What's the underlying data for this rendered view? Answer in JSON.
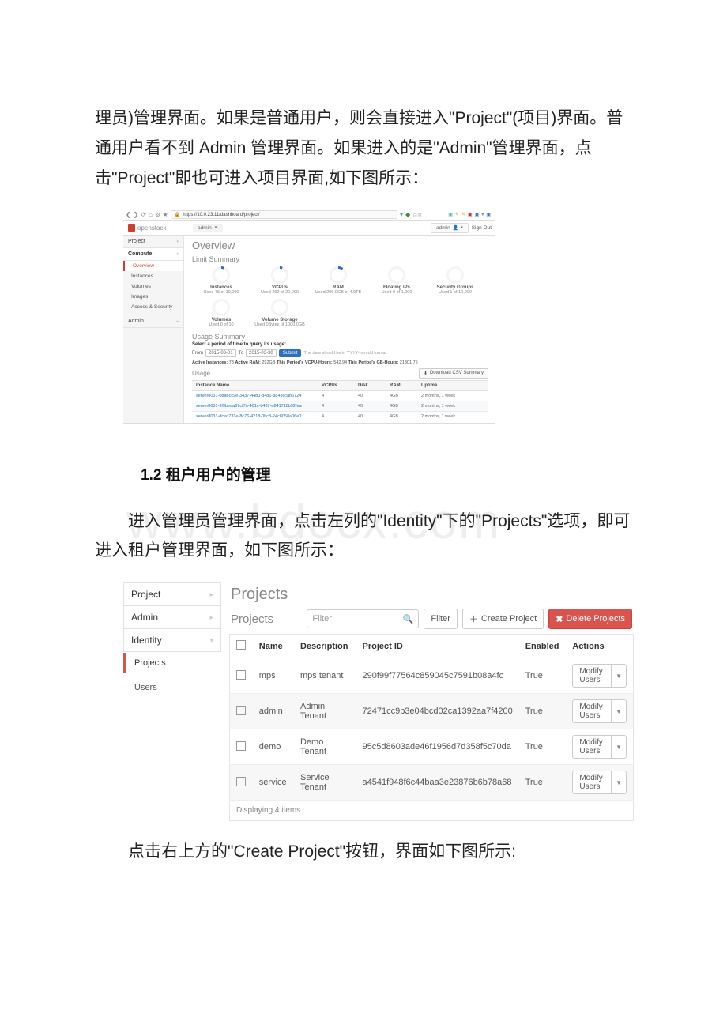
{
  "doc": {
    "para1_a": "理员)管理界面。如果是普通用户，则会直接进入\"Project\"(项目)界面。普通用户看不到 Admin 管理界面。如果进入的是\"Admin\"管理界面，点击\"Project\"即也可进入项目界面,如下图所示：",
    "section_h": "1.2 租户用户的管理",
    "para2": "进入管理员管理界面，点击左列的\"Identity\"下的\"Projects\"选项，即可进入租户管理界面，如下图所示：",
    "para3": "点击右上方的\"Create Project\"按钮，界面如下图所示:",
    "watermark": "www.bdocx.com"
  },
  "ss1": {
    "url": "https://10.0.23.11/dashboard/project/",
    "brand": "openstack",
    "tenant_dd": "admin",
    "user": "admin",
    "signout": "Sign Out",
    "side": {
      "sec_project": "Project",
      "sec_compute": "Compute",
      "items": [
        "Overview",
        "Instances",
        "Volumes",
        "Images",
        "Access & Security"
      ],
      "sec_admin": "Admin"
    },
    "h1": "Overview",
    "limit_h": "Limit Summary",
    "limits": [
      {
        "t": "Instances",
        "s": "Used 75 of 10,000",
        "g": "part"
      },
      {
        "t": "VCPUs",
        "s": "Used 292 of 20,000",
        "g": "part"
      },
      {
        "t": "RAM",
        "s": "Used 296.0GB of 4.9TB",
        "g": "ram"
      },
      {
        "t": "Floating IPs",
        "s": "Used 0 of 1,000",
        "g": ""
      },
      {
        "t": "Security Groups",
        "s": "Used 1 of 10,000",
        "g": ""
      },
      {
        "t": "Volumes",
        "s": "Used 0 of 10",
        "g": ""
      },
      {
        "t": "Volume Storage",
        "s": "Used 0Bytes of 1000.0GB",
        "g": ""
      }
    ],
    "usage_h": "Usage Summary",
    "period_label": "Select a period of time to query its usage:",
    "from_l": "From",
    "from_v": "2015-03-01",
    "to_l": "To",
    "to_v": "2015-03-30",
    "submit": "Submit",
    "date_hint": "The date should be in YYYY-mm-dd format.",
    "summary": {
      "pre_a": "Active Instances:",
      "a": "73",
      "pre_r": "Active RAM:",
      "r": "292GB",
      "pre_v": "This Period's VCPU-Hours:",
      "v": "542.94",
      "pre_g": "This Period's GB-Hours:",
      "g": "21801.75"
    },
    "table_h": "Usage",
    "dlcsv": "Download CSV Summary",
    "cols": [
      "Instance Name",
      "VCPUs",
      "Disk",
      "RAM",
      "Uptime"
    ],
    "rows": [
      {
        "n": "server8031-08a6cc9e-3437-44b0-d481-8843ccab6724",
        "v": "4",
        "d": "40",
        "r": "4GB",
        "u": "2 months, 1 week"
      },
      {
        "n": "server8031-9f9beaa67cf7a-401c-b437-a841718b92fea",
        "v": "4",
        "d": "40",
        "r": "4GB",
        "u": "2 months, 1 week"
      },
      {
        "n": "server8031-dced731e-8c76-4218-0bc8-24c8058a06e0",
        "v": "4",
        "d": "40",
        "r": "4GB",
        "u": "2 months, 1 week"
      }
    ]
  },
  "ss2": {
    "side": {
      "sec_project": "Project",
      "sec_admin": "Admin",
      "sec_identity": "Identity",
      "item_projects": "Projects",
      "item_users": "Users"
    },
    "h1": "Projects",
    "h2": "Projects",
    "filter_ph": "Filter",
    "btn_filter": "Filter",
    "btn_create": "Create Project",
    "btn_delete": "Delete Projects",
    "cols": {
      "name": "Name",
      "desc": "Description",
      "pid": "Project ID",
      "enabled": "Enabled",
      "actions": "Actions"
    },
    "action_label": "Modify Users",
    "rows": [
      {
        "n": "mps",
        "d": "mps tenant",
        "p": "290f99f77564c859045c7591b08a4fc",
        "e": "True"
      },
      {
        "n": "admin",
        "d": "Admin Tenant",
        "p": "72471cc9b3e04bcd02ca1392aa7f4200",
        "e": "True"
      },
      {
        "n": "demo",
        "d": "Demo Tenant",
        "p": "95c5d8603ade46f1956d7d358f5c70da",
        "e": "True"
      },
      {
        "n": "service",
        "d": "Service Tenant",
        "p": "a4541f948f6c44baa3e23876b6b78a68",
        "e": "True"
      }
    ],
    "footer": "Displaying 4 items"
  }
}
